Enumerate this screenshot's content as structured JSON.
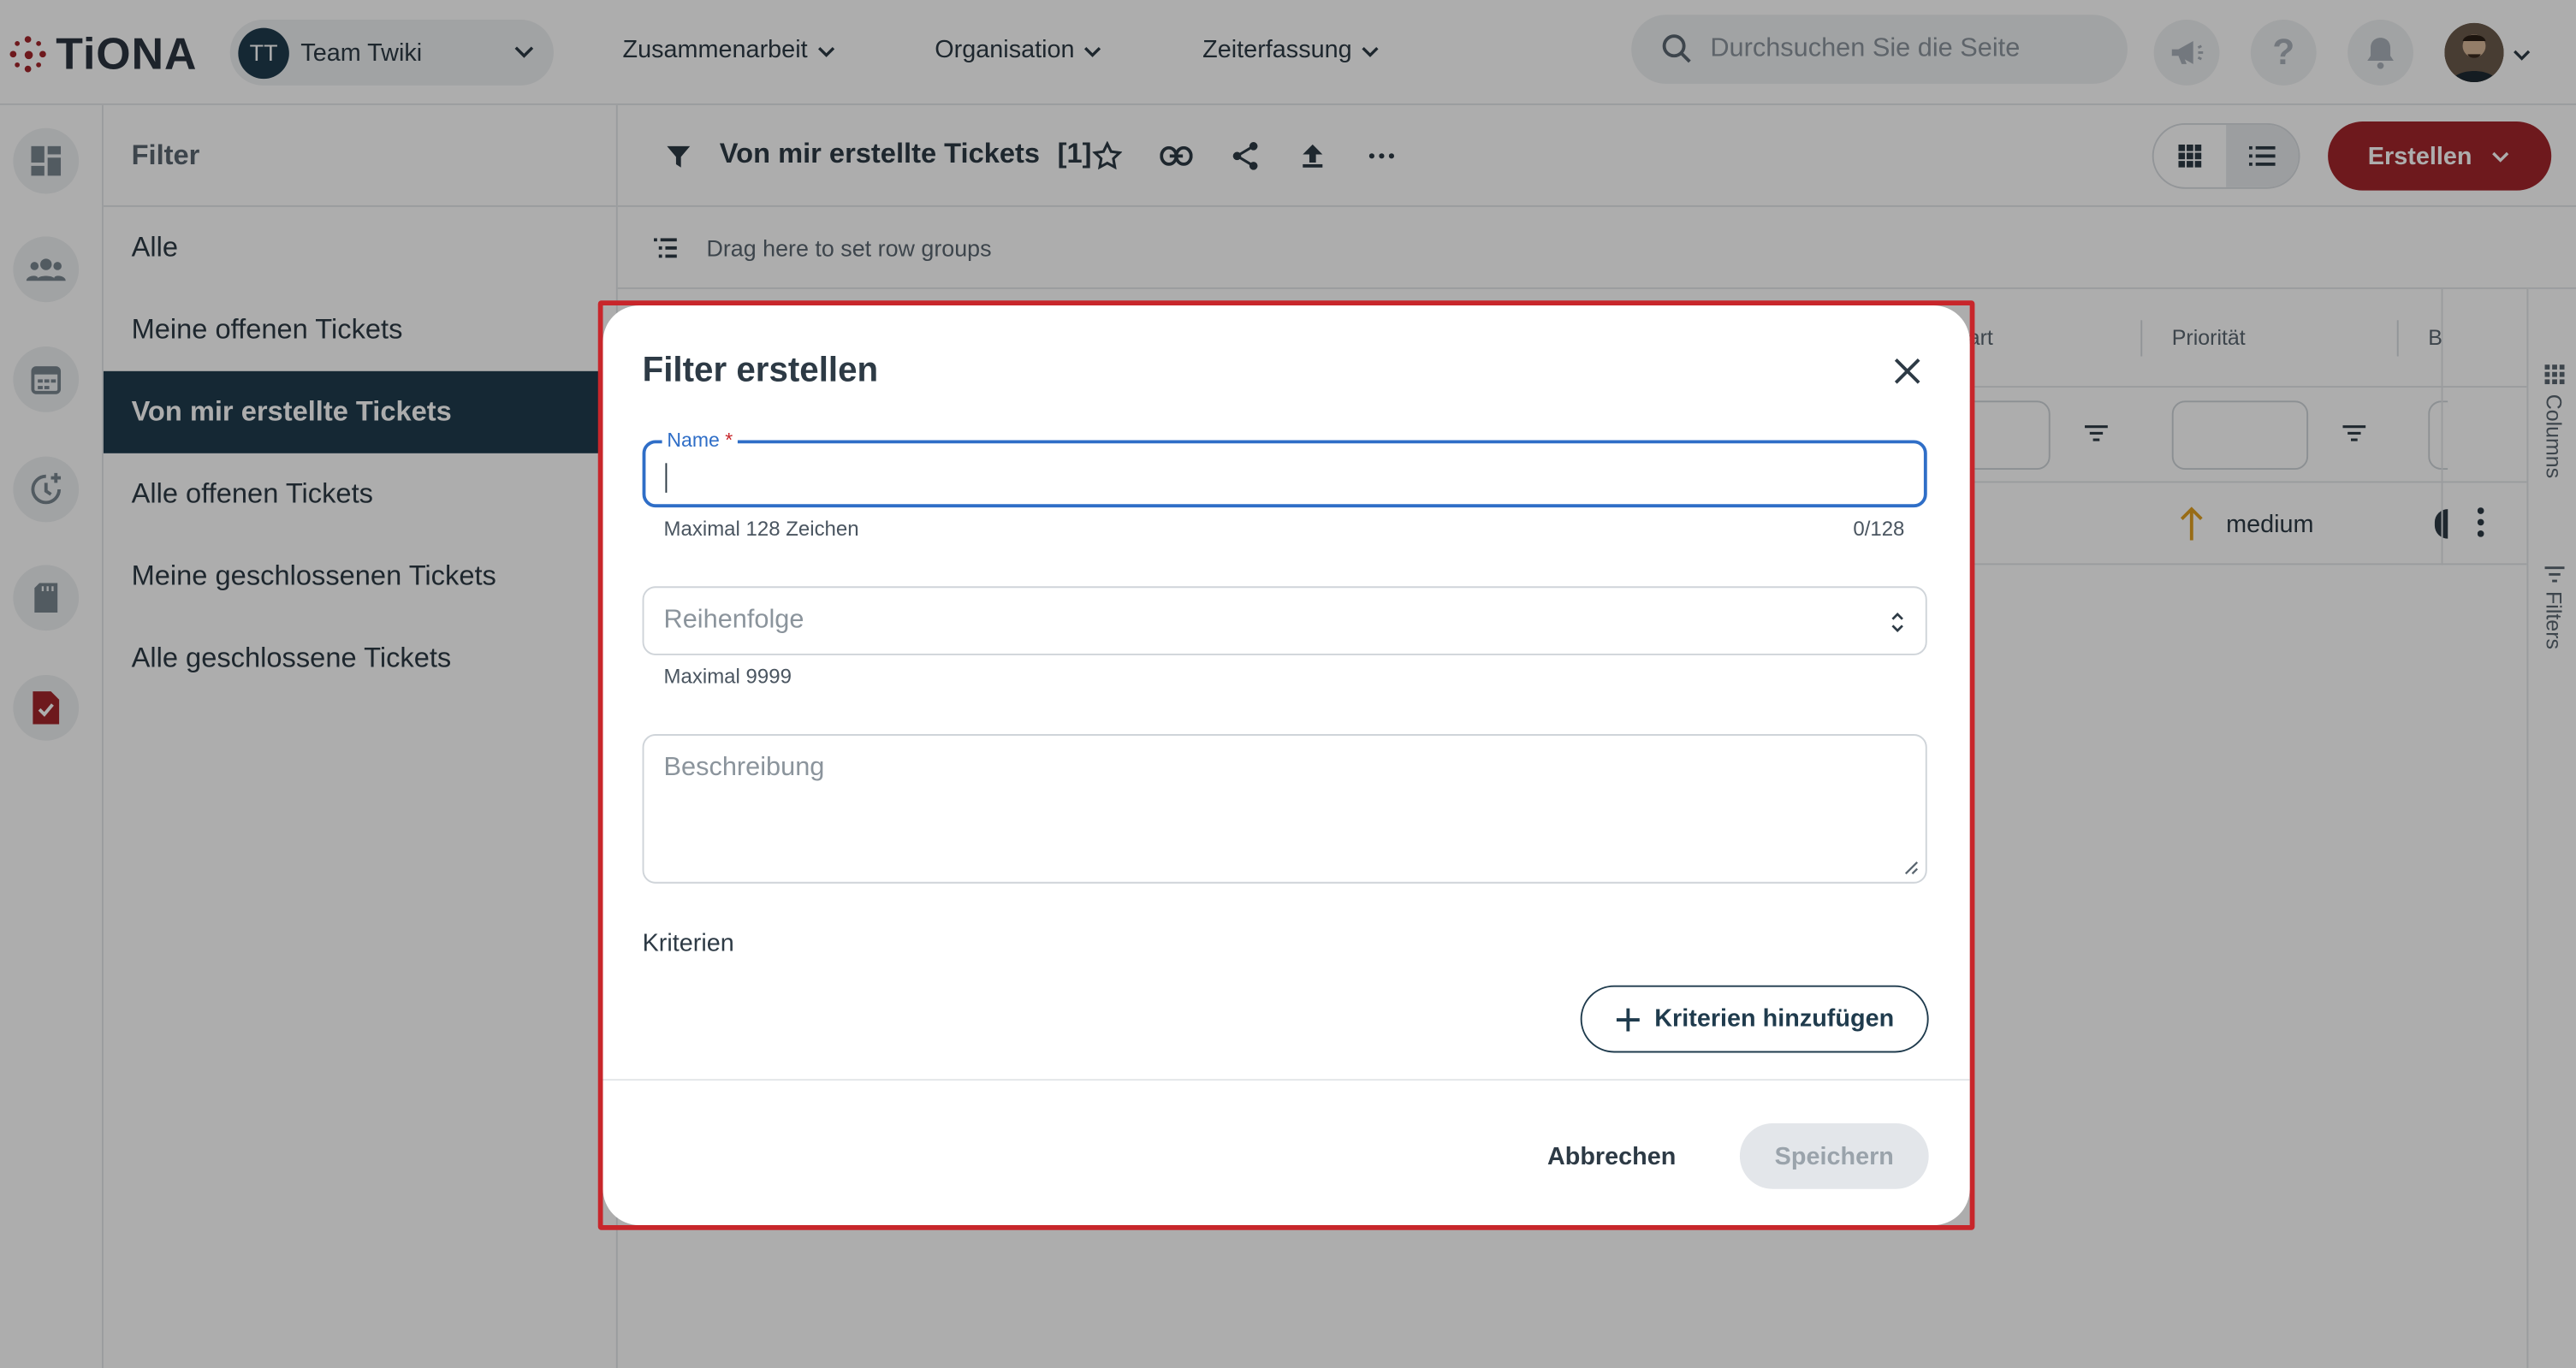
{
  "app": {
    "name": "TiONA"
  },
  "team": {
    "initials": "TT",
    "name": "Team Twiki"
  },
  "nav": [
    {
      "label": "Zusammenarbeit"
    },
    {
      "label": "Organisation"
    },
    {
      "label": "Zeiterfassung"
    }
  ],
  "search": {
    "placeholder": "Durchsuchen Sie die Seite"
  },
  "topbar_icons": [
    "megaphone-icon",
    "help-icon",
    "bell-icon"
  ],
  "rail_icons": [
    "dashboard-icon",
    "team-icon",
    "calendar-icon",
    "time-tracking-icon",
    "document-icon",
    "tickets-icon"
  ],
  "filter_panel": {
    "header": "Filter",
    "items": [
      {
        "label": "Alle"
      },
      {
        "label": "Meine offenen Tickets"
      },
      {
        "label": "Von mir erstellte Tickets",
        "active": true
      },
      {
        "label": "Alle offenen Tickets"
      },
      {
        "label": "Meine geschlossenen Tickets"
      },
      {
        "label": "Alle geschlossene Tickets"
      }
    ]
  },
  "toolbar": {
    "title": "Von mir erstellte Tickets",
    "count": "[1]",
    "create_label": "Erstellen"
  },
  "rowgroup": {
    "label": "Drag here to set row groups"
  },
  "grid": {
    "columns": [
      {
        "label": "art"
      },
      {
        "label": "Priorität"
      },
      {
        "label": "B"
      }
    ],
    "row": {
      "priority": "medium"
    },
    "side_tabs": [
      "Columns",
      "Filters"
    ]
  },
  "dialog": {
    "title": "Filter erstellen",
    "name_label": "Name",
    "name_required": "*",
    "name_hint": "Maximal 128 Zeichen",
    "name_counter": "0/128",
    "order_placeholder": "Reihenfolge",
    "order_hint": "Maximal 9999",
    "description_placeholder": "Beschreibung",
    "criteria_label": "Kriterien",
    "add_criteria_label": "Kriterien hinzufügen",
    "cancel_label": "Abbrechen",
    "save_label": "Speichern"
  },
  "colors": {
    "brand": "#a3262b",
    "primary_dark": "#1f3b4d",
    "focus_blue": "#2f6ec7",
    "priority_arrow": "#e0a020"
  }
}
